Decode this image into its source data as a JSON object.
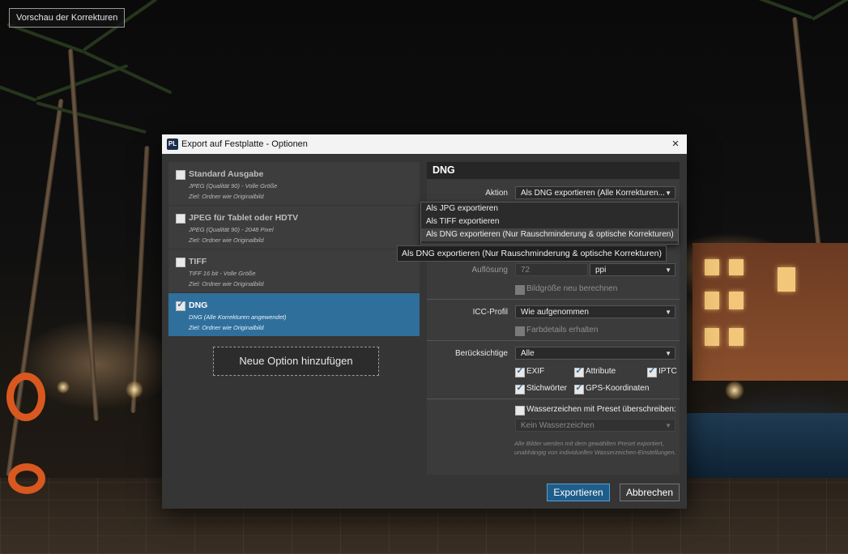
{
  "preview_button": "Vorschau der Korrekturen",
  "dialog": {
    "title": "Export auf Festplatte - Optionen",
    "app_icon": "PL",
    "close_icon": "×"
  },
  "presets": [
    {
      "name": "Standard Ausgabe",
      "line1": "JPEG (Qualität 90) - Volle Größe",
      "line2": "Ziel: Ordner wie Originalbild",
      "checked": false
    },
    {
      "name": "JPEG für Tablet oder HDTV",
      "line1": "JPEG (Qualität 90) - 2048 Pixel",
      "line2": "Ziel: Ordner wie Originalbild",
      "checked": false
    },
    {
      "name": "TIFF",
      "line1": "TIFF 16 bit - Volle Größe",
      "line2": "Ziel: Ordner wie Originalbild",
      "checked": false
    },
    {
      "name": "DNG",
      "line1": "DNG (Alle Korrekturen angewendet)",
      "line2": "Ziel: Ordner wie Originalbild",
      "checked": true
    }
  ],
  "add_option_button": "Neue Option hinzufügen",
  "panel": {
    "heading": "DNG",
    "action_label": "Aktion",
    "action_value": "Als DNG exportieren (Alle Korrekturen...",
    "action_options": [
      "Als JPG exportieren",
      "Als TIFF exportieren",
      "Als DNG exportieren (Nur Rauschminderung & optische Korrekturen)"
    ],
    "tooltip": "Als DNG exportieren (Nur Rauschminderung & optische Korrekturen)",
    "resolution_label": "Auflösung",
    "resolution_value": "72",
    "resolution_unit": "ppi",
    "resize_label": "Bildgröße neu berechnen",
    "icc_label": "ICC-Profil",
    "icc_value": "Wie aufgenommen",
    "color_details_label": "Farbdetails erhalten",
    "include_label": "Berücksichtige",
    "include_value": "Alle",
    "meta": {
      "exif": "EXIF",
      "attribute": "Attribute",
      "iptc": "IPTC",
      "keywords": "Stichwörter",
      "gps": "GPS-Koordinaten"
    },
    "watermark_label": "Wasserzeichen mit Preset überschreiben:",
    "watermark_value": "Kein Wasserzeichen",
    "note": "Alle Bilder werden mit dem gewählten Preset exportiert, unabhängig von individuellen Wasserzeichen-Einstellungen."
  },
  "buttons": {
    "export": "Exportieren",
    "cancel": "Abbrechen"
  },
  "arrow_glyph": "▼",
  "check_glyph": "✓",
  "colors": {
    "accent": "#2f6f9c",
    "primary_button": "#1f5d8a"
  }
}
